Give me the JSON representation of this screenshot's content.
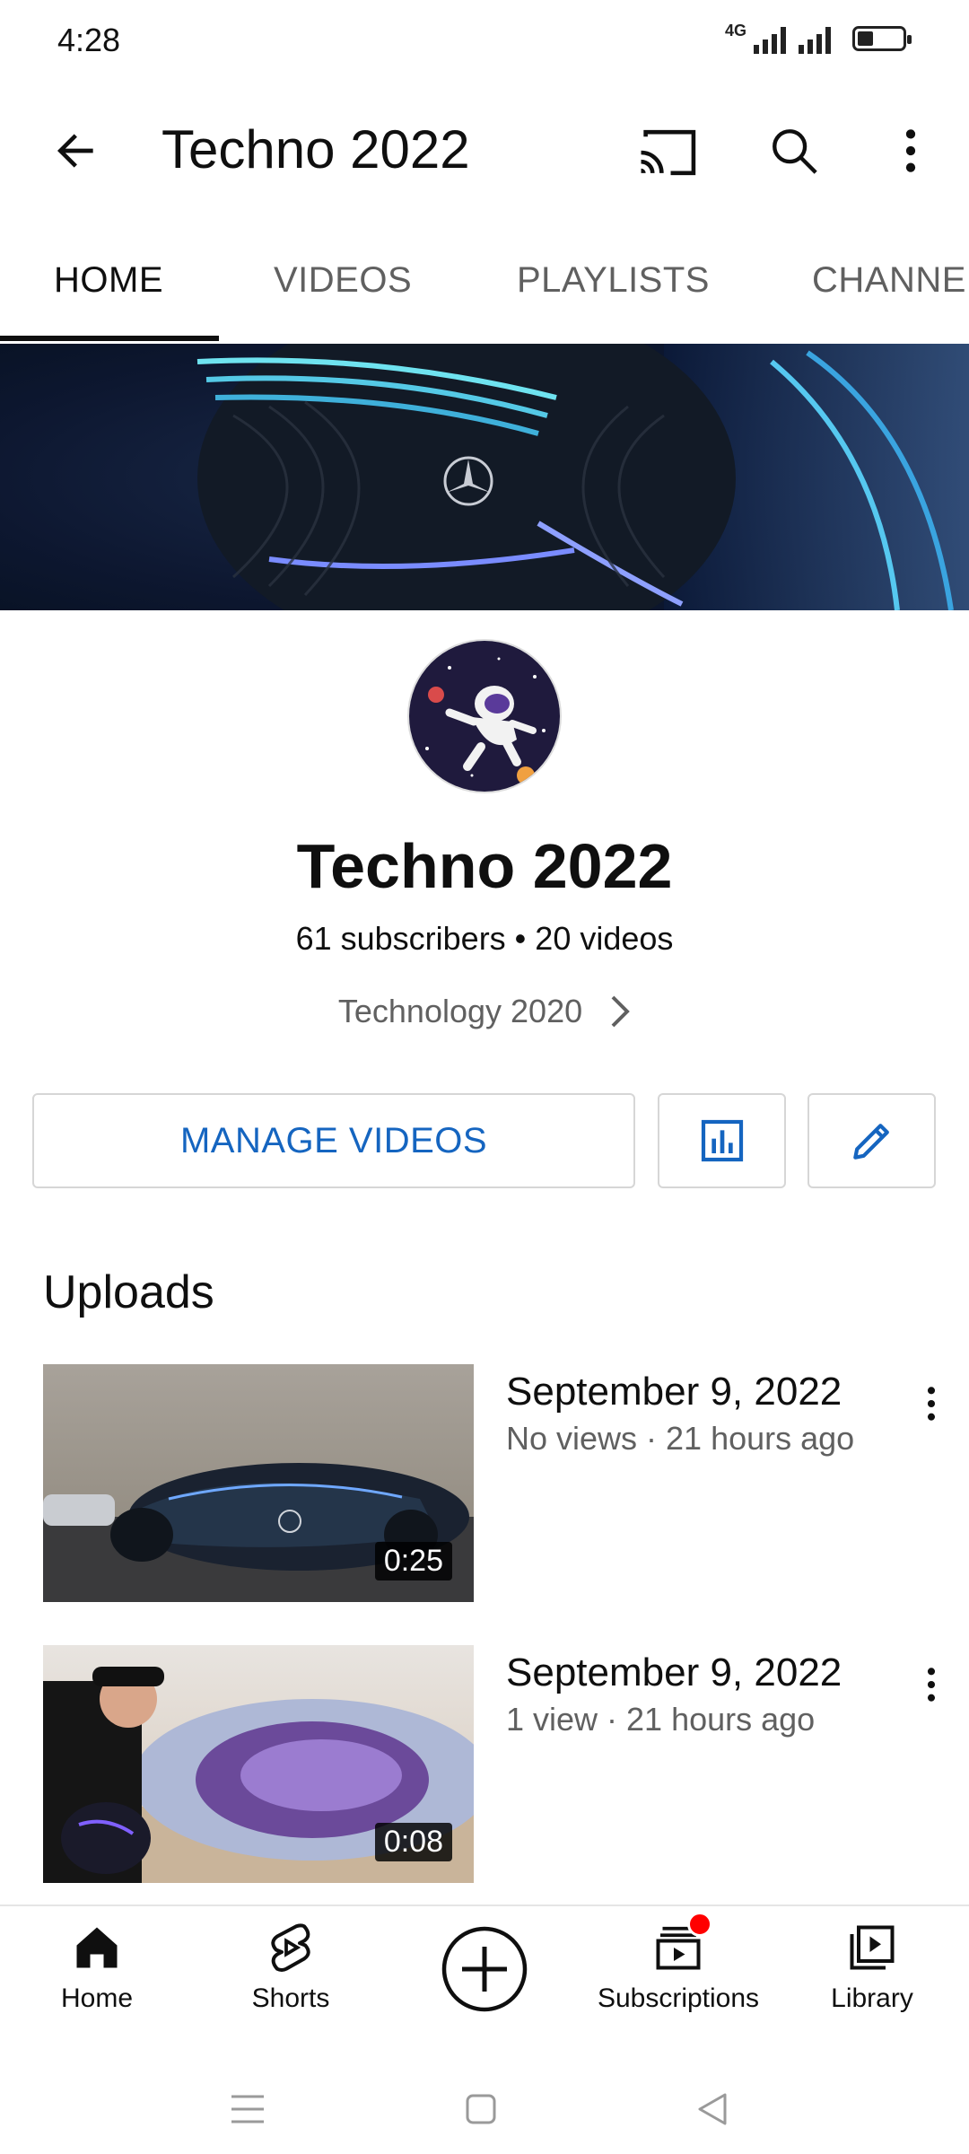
{
  "status_bar": {
    "time": "4:28",
    "network": "4G"
  },
  "app_bar": {
    "title": "Techno 2022"
  },
  "tabs": [
    {
      "label": "HOME",
      "active": true
    },
    {
      "label": "VIDEOS",
      "active": false
    },
    {
      "label": "PLAYLISTS",
      "active": false
    },
    {
      "label": "CHANNE",
      "active": false
    }
  ],
  "channel": {
    "name": "Techno 2022",
    "stats": "61 subscribers • 20 videos",
    "link_text": "Technology 2020"
  },
  "actions": {
    "manage_label": "MANAGE VIDEOS"
  },
  "uploads": {
    "title": "Uploads",
    "videos": [
      {
        "title": "September 9, 2022",
        "meta": "No views · 21 hours ago",
        "duration": "0:25"
      },
      {
        "title": "September 9, 2022",
        "meta": "1 view · 21 hours ago",
        "duration": "0:08"
      }
    ]
  },
  "bottom_nav": {
    "items": [
      {
        "label": "Home",
        "icon": "home-icon"
      },
      {
        "label": "Shorts",
        "icon": "shorts-icon"
      },
      {
        "label": "",
        "icon": "create-icon"
      },
      {
        "label": "Subscriptions",
        "icon": "subscriptions-icon"
      },
      {
        "label": "Library",
        "icon": "library-icon"
      }
    ]
  },
  "colors": {
    "accent": "#1565c0",
    "badge": "#ff0000",
    "text": "#0f0f0f",
    "secondary": "#606060"
  }
}
